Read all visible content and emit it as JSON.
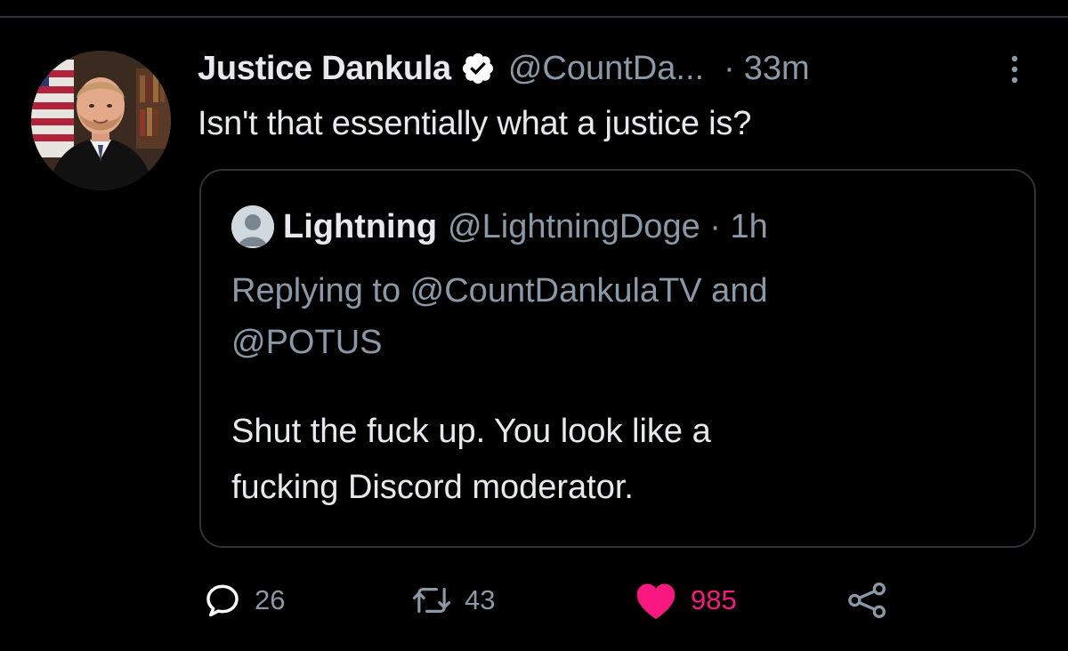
{
  "author": {
    "display_name": "Justice Dankula",
    "handle": "@CountDa...",
    "separator": "·",
    "time": "33m",
    "verified": true
  },
  "tweet": {
    "text": "Isn't that essentially what a justice is?"
  },
  "quoted": {
    "display_name": "Lightning",
    "handle_time": "@LightningDoge · 1h",
    "replying_line1": "Replying to @CountDankulaTV and",
    "replying_line2": "@POTUS",
    "text_line1": "Shut the fuck up. You look like a",
    "text_line2": "fucking Discord moderator."
  },
  "actions": {
    "replies": "26",
    "retweets": "43",
    "likes": "985",
    "liked": true
  },
  "icons": {
    "verified": "verified-badge-icon",
    "more": "more-vertical-icon",
    "reply": "reply-icon",
    "retweet": "retweet-icon",
    "like": "heart-icon",
    "share": "share-icon"
  },
  "colors": {
    "background": "#000000",
    "text": "#e7e9ea",
    "secondary": "#8b98a5",
    "border": "#2f3336",
    "like": "#f91880"
  }
}
